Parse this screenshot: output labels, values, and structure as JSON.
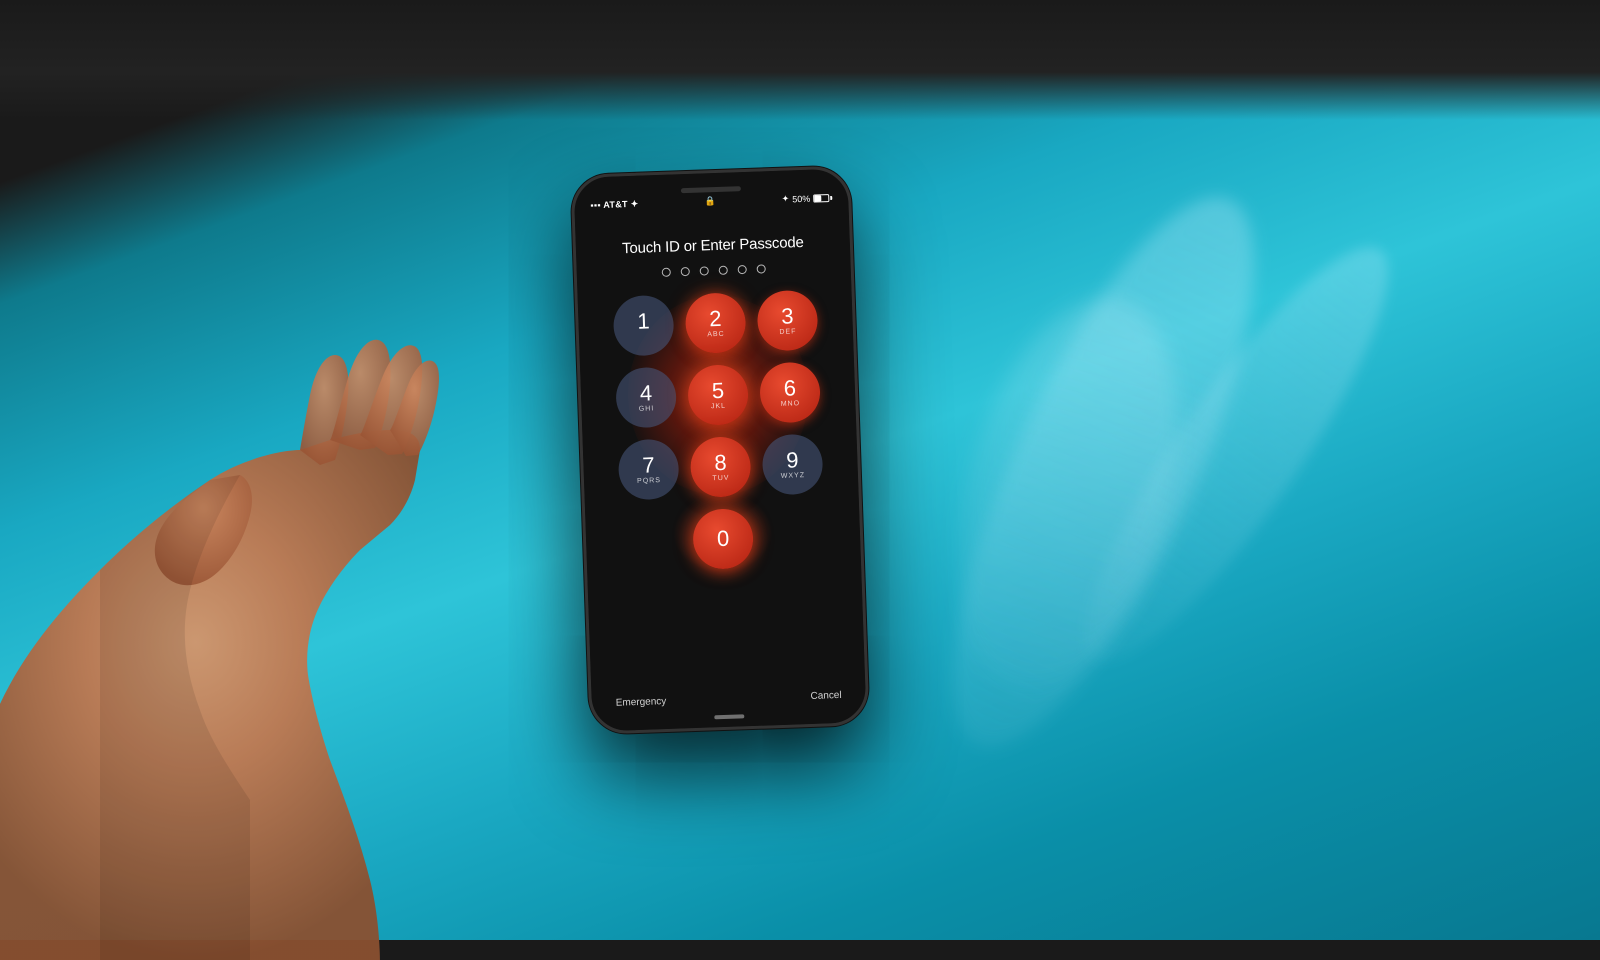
{
  "background": {
    "description": "blue table surface with dark top area and light rays"
  },
  "phone": {
    "status_bar": {
      "carrier": "AT&T",
      "wifi_signal": "wifi",
      "lock_icon": "🔒",
      "signal_strength": "▶ 4 50%",
      "battery": "50%"
    },
    "lock_screen": {
      "title": "Touch ID or Enter Passcode",
      "dots_count": 6,
      "keypad": [
        {
          "num": "1",
          "letters": ""
        },
        {
          "num": "2",
          "letters": "ABC"
        },
        {
          "num": "3",
          "letters": "DEF"
        },
        {
          "num": "4",
          "letters": "GHI"
        },
        {
          "num": "5",
          "letters": "JKL"
        },
        {
          "num": "6",
          "letters": "MNO"
        },
        {
          "num": "7",
          "letters": "PQRS"
        },
        {
          "num": "8",
          "letters": "TUV"
        },
        {
          "num": "9",
          "letters": "WXYZ"
        },
        {
          "num": "0",
          "letters": ""
        }
      ],
      "bottom_left": "Emergency",
      "bottom_right": "Cancel"
    }
  }
}
